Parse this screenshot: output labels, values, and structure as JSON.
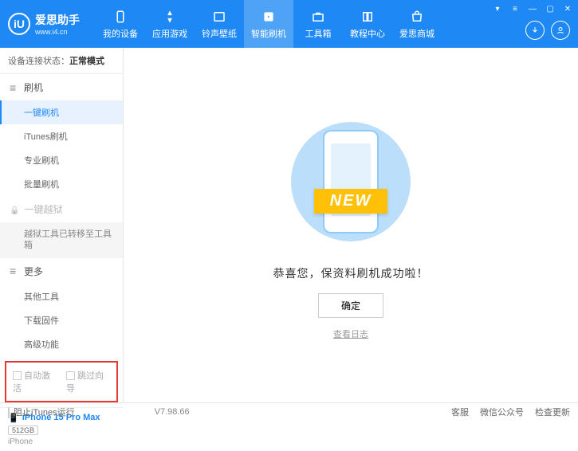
{
  "header": {
    "logo_title": "爱思助手",
    "logo_url": "www.i4.cn",
    "logo_letter": "iU",
    "nav": [
      {
        "label": "我的设备"
      },
      {
        "label": "应用游戏"
      },
      {
        "label": "铃声壁纸"
      },
      {
        "label": "智能刷机"
      },
      {
        "label": "工具箱"
      },
      {
        "label": "教程中心"
      },
      {
        "label": "爱思商城"
      }
    ]
  },
  "sidebar": {
    "status_label": "设备连接状态：",
    "status_value": "正常模式",
    "sec_flash": "刷机",
    "items_flash": [
      "一键刷机",
      "iTunes刷机",
      "专业刷机",
      "批量刷机"
    ],
    "sec_jailbreak": "一键越狱",
    "jailbreak_note": "越狱工具已转移至工具箱",
    "sec_more": "更多",
    "items_more": [
      "其他工具",
      "下载固件",
      "高级功能"
    ],
    "auto_activate": "自动激活",
    "skip_guide": "跳过向导"
  },
  "device": {
    "name": "iPhone 15 Pro Max",
    "storage": "512GB",
    "type": "iPhone"
  },
  "main": {
    "banner": "NEW",
    "success": "恭喜您，保资料刷机成功啦！",
    "ok": "确定",
    "log": "查看日志"
  },
  "footer": {
    "block_itunes": "阻止iTunes运行",
    "version": "V7.98.66",
    "right": [
      "客服",
      "微信公众号",
      "检查更新"
    ]
  }
}
